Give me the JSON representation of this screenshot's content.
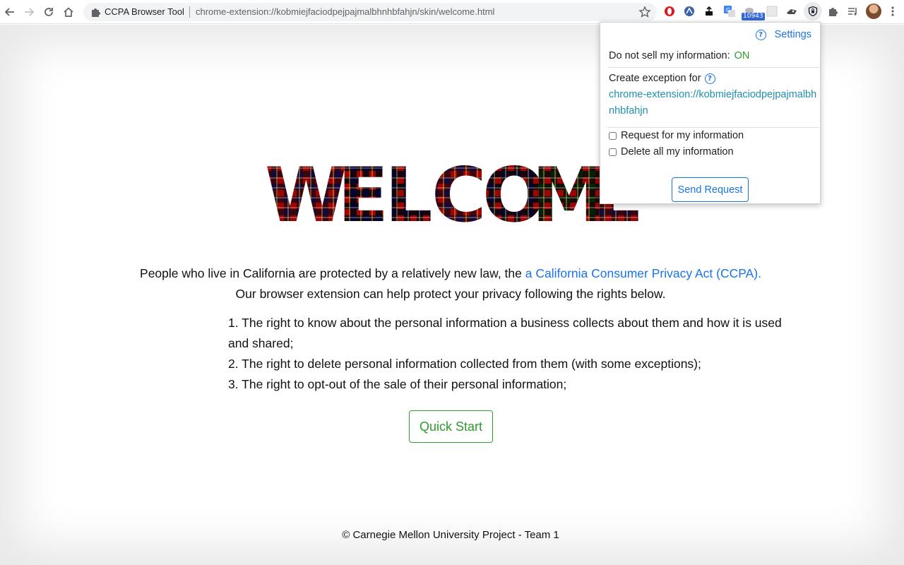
{
  "browser": {
    "omnibox_site": "CCPA Browser Tool",
    "omnibox_url": "chrome-extension://kobmiejfaciodpejpajmalbhnhbfahjn/skin/welcome.html",
    "ext_badge": "10943",
    "icons": [
      "back-arrow-icon",
      "forward-arrow-icon",
      "reload-icon",
      "home-icon",
      "puzzle-icon",
      "star-icon",
      "opera-icon",
      "nordvpn-icon",
      "upload-icon",
      "translate-icon",
      "ghost-icon",
      "shield-icon",
      "extensions-icon",
      "media-queue-icon",
      "more-icon"
    ]
  },
  "page": {
    "welcome_letters": [
      "W",
      "E",
      "L",
      "C",
      "O",
      "M",
      "E"
    ],
    "intro_line1": "People who live in California are protected by a relatively new law, the ",
    "intro_link": "a California Consumer Privacy Act (CCPA).",
    "intro_line2": "Our browser extension can help protect your privacy following the rights below.",
    "rights": [
      "1. The right to know about the personal information a business collects about them and how it is used and shared;",
      "2. The right to delete personal information collected from them (with some exceptions);",
      "3. The right to opt-out of the sale of their personal information;"
    ],
    "quick_start": "Quick Start",
    "footer": "© Carnegie Mellon University Project - Team 1"
  },
  "popup": {
    "help_glyph": "?",
    "settings": "Settings",
    "do_not_sell_label": "Do not sell my information:",
    "do_not_sell_value": "ON",
    "exception_label": "Create exception for",
    "exception_url": "chrome-extension://kobmiejfaciodpejpajmalbhnhbfahjn",
    "request_info_label": "Request for my information",
    "delete_info_label": "Delete all my information",
    "send_button": "Send Request"
  },
  "colors": {
    "link_blue": "#1a73e8",
    "on_green": "#2e9a2e",
    "url_teal": "#1f8fb0",
    "plaid_a": "#4a2a7a",
    "plaid_b": "#c8221c",
    "plaid_c": "#1b1b6e",
    "plaid_d": "#1d5a2a"
  }
}
